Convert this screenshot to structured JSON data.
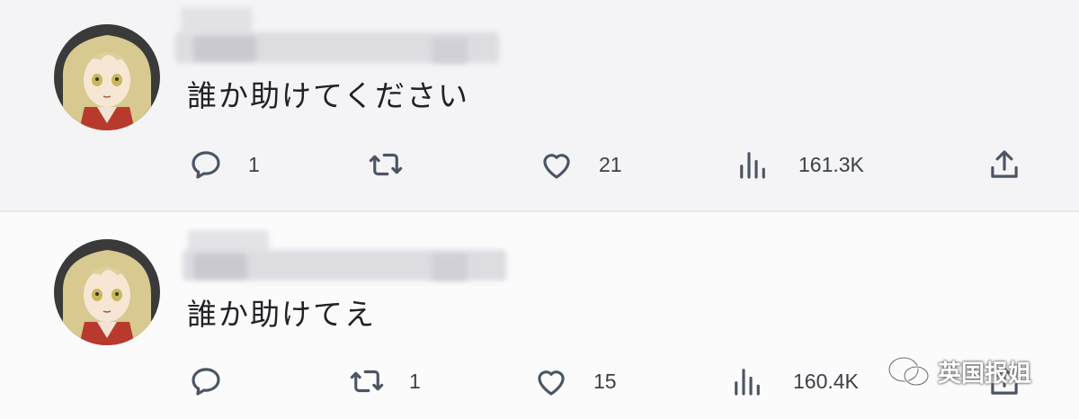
{
  "tweets": [
    {
      "text": "誰か助けてください",
      "replies": "1",
      "retweets": "",
      "likes": "21",
      "views": "161.3K"
    },
    {
      "text": "誰か助けてえ",
      "replies": "",
      "retweets": "1",
      "likes": "15",
      "views": "160.4K"
    }
  ],
  "icons": {
    "reply": "speech-bubble-icon",
    "retweet": "retweet-arrows-icon",
    "like": "heart-icon",
    "views": "bar-chart-icon",
    "share": "share-upload-icon"
  },
  "watermark": {
    "text": "英国报姐"
  },
  "colors": {
    "icon": "#4b5563",
    "text": "#222226",
    "tweet1_bg": "#f4f4f6",
    "tweet2_bg": "#fbfbfc"
  }
}
